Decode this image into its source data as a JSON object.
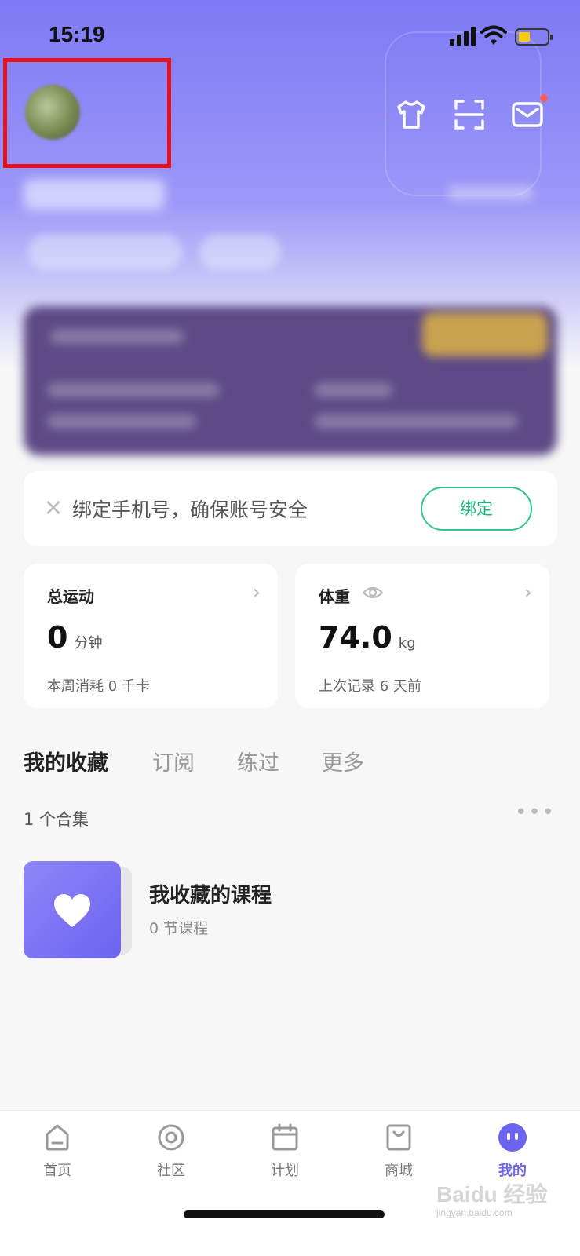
{
  "status_bar": {
    "time": "15:19"
  },
  "bind_prompt": {
    "text": "绑定手机号，确保账号安全",
    "button_label": "绑定"
  },
  "stats": [
    {
      "title": "总运动",
      "value": "0",
      "unit": "分钟",
      "sub": "本周消耗 0 千卡"
    },
    {
      "title": "体重",
      "value": "74.0",
      "unit": "kg",
      "sub": "上次记录 6 天前"
    }
  ],
  "tabs": [
    {
      "label": "我的收藏",
      "active": true
    },
    {
      "label": "订阅",
      "active": false
    },
    {
      "label": "练过",
      "active": false
    },
    {
      "label": "更多",
      "active": false
    }
  ],
  "collection": {
    "count_label": "1 个合集"
  },
  "course": {
    "title": "我收藏的课程",
    "subtitle": "0 节课程"
  },
  "bottom_nav": [
    {
      "label": "首页",
      "icon": "home-icon",
      "active": false
    },
    {
      "label": "社区",
      "icon": "community-icon",
      "active": false
    },
    {
      "label": "计划",
      "icon": "calendar-icon",
      "active": false
    },
    {
      "label": "商城",
      "icon": "shop-icon",
      "active": false
    },
    {
      "label": "我的",
      "icon": "profile-icon",
      "active": true
    }
  ],
  "watermark": {
    "brand": "Baidu 经验",
    "site": "jingyan.baidu.com"
  },
  "colors": {
    "accent": "#6c63f0",
    "bind_green": "#1db67b",
    "hero_top": "#7d79f4",
    "highlight_frame": "#e8101a"
  }
}
